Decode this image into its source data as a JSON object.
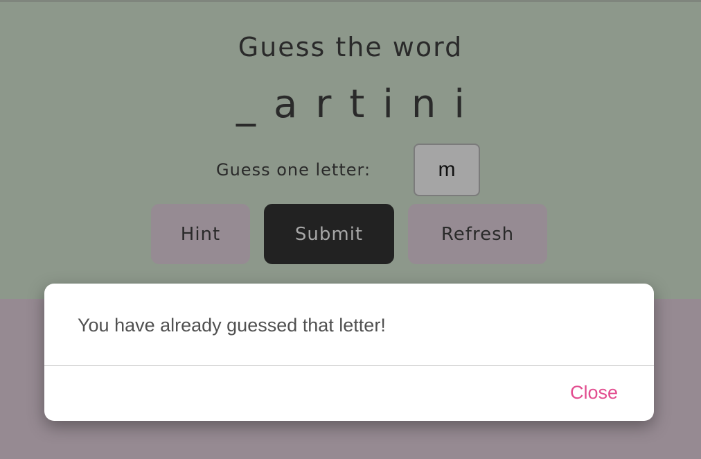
{
  "game": {
    "title": "Guess the word",
    "word_display": "_artini",
    "guess_label": "Guess one letter:",
    "guess_input_value": "m"
  },
  "buttons": {
    "hint_label": "Hint",
    "submit_label": "Submit",
    "refresh_label": "Refresh"
  },
  "modal": {
    "message": "You have already guessed that letter!",
    "close_label": "Close"
  },
  "colors": {
    "top_background": "#8d988b",
    "bottom_background": "#968a92",
    "secondary_button": "#968b93",
    "primary_button": "#222222",
    "close_link": "#e24c8f"
  }
}
